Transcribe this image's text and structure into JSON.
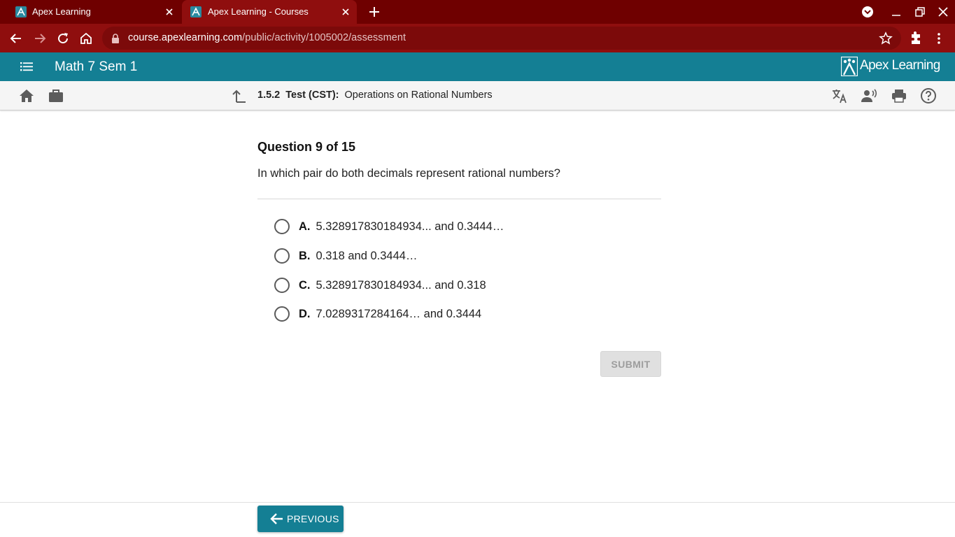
{
  "browser": {
    "tabs": [
      {
        "title": "Apex Learning",
        "active": false
      },
      {
        "title": "Apex Learning - Courses",
        "active": true
      }
    ],
    "url_host": "course.apexlearning.com",
    "url_path": "/public/activity/1005002/assessment",
    "colors": {
      "tabstrip": "#6f0000",
      "toolbar": "#8f0e0e"
    }
  },
  "app": {
    "course_title": "Math 7 Sem 1",
    "brand": "Apex Learning",
    "accent": "#147f94"
  },
  "activity": {
    "number": "1.5.2",
    "kind": "Test (CST):",
    "title": "Operations on Rational Numbers",
    "icons": [
      "home-icon",
      "briefcase-icon",
      "up-arrow-icon",
      "translate-icon",
      "text-to-speech-icon",
      "print-icon",
      "help-icon"
    ]
  },
  "question": {
    "heading": "Question 9 of 15",
    "text": "In which pair do both decimals represent rational numbers?",
    "options": [
      {
        "letter": "A.",
        "text": "5.328917830184934... and 0.3444…",
        "selected": false
      },
      {
        "letter": "B.",
        "text": "0.318 and 0.3444…",
        "selected": false
      },
      {
        "letter": "C.",
        "text": "5.328917830184934... and 0.318",
        "selected": false
      },
      {
        "letter": "D.",
        "text": "7.0289317284164… and 0.3444",
        "selected": false
      }
    ],
    "submit_label": "SUBMIT",
    "submit_enabled": false
  },
  "footer": {
    "previous_label": "PREVIOUS"
  }
}
